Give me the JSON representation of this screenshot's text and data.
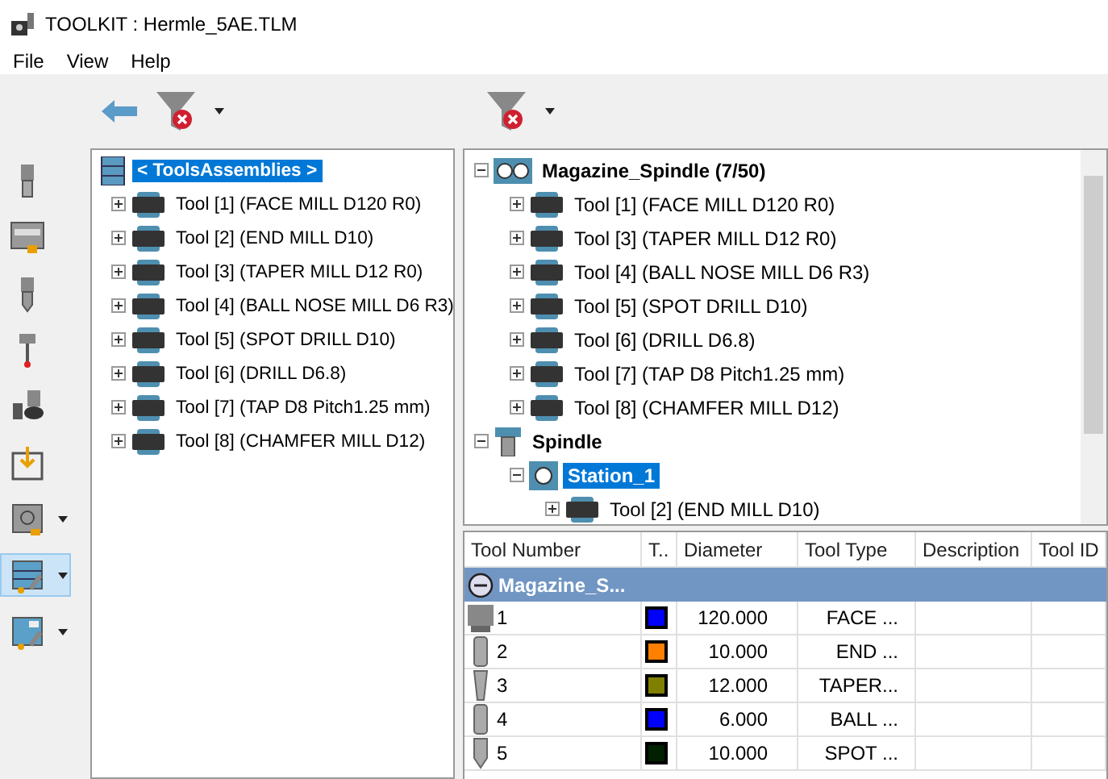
{
  "window": {
    "title": "TOOLKIT : Hermle_5AE.TLM"
  },
  "menu": [
    "File",
    "View",
    "Help"
  ],
  "left_toolbar": [
    {
      "kind": "endmill",
      "dropdown": false,
      "selected": false
    },
    {
      "kind": "holder",
      "dropdown": false,
      "selected": false
    },
    {
      "kind": "drill",
      "dropdown": false,
      "selected": false
    },
    {
      "kind": "probe",
      "dropdown": false,
      "selected": false
    },
    {
      "kind": "assembly",
      "dropdown": false,
      "selected": false
    },
    {
      "kind": "import",
      "dropdown": false,
      "selected": false
    },
    {
      "kind": "safe",
      "dropdown": true,
      "selected": false
    },
    {
      "kind": "table",
      "dropdown": true,
      "selected": true
    },
    {
      "kind": "split",
      "dropdown": true,
      "selected": false
    }
  ],
  "left_tree": [
    {
      "label": "< ToolsAssemblies >",
      "kind": "assemblies",
      "selected": true,
      "children": [
        {
          "label": "Tool [1] (FACE MILL D120 R0)",
          "kind": "tool",
          "expanded": false,
          "selected": false
        },
        {
          "label": "Tool [2] (END MILL D10)",
          "kind": "tool",
          "expanded": false,
          "selected": false
        },
        {
          "label": "Tool [3] (TAPER MILL D12 R0)",
          "kind": "tool",
          "expanded": false,
          "selected": false
        },
        {
          "label": "Tool [4] (BALL NOSE MILL D6 R3)",
          "kind": "tool",
          "expanded": false,
          "selected": false
        },
        {
          "label": "Tool [5] (SPOT DRILL D10)",
          "kind": "tool",
          "expanded": false,
          "selected": false
        },
        {
          "label": "Tool [6] (DRILL D6.8)",
          "kind": "tool",
          "expanded": false,
          "selected": false
        },
        {
          "label": "Tool [7] (TAP D8 Pitch1.25 mm)",
          "kind": "tool",
          "expanded": false,
          "selected": false
        },
        {
          "label": "Tool [8] (CHAMFER MILL D12)",
          "kind": "tool",
          "expanded": false,
          "selected": false
        }
      ]
    }
  ],
  "right_tree": [
    {
      "label": "Magazine_Spindle (7/50)",
      "kind": "magazine",
      "expanded": true,
      "selected": false,
      "children": [
        {
          "label": "Tool [1] (FACE MILL D120 R0)",
          "kind": "tool",
          "expanded": false,
          "selected": false
        },
        {
          "label": "Tool [3] (TAPER MILL D12 R0)",
          "kind": "tool",
          "expanded": false,
          "selected": false
        },
        {
          "label": "Tool [4] (BALL NOSE MILL D6 R3)",
          "kind": "tool",
          "expanded": false,
          "selected": false
        },
        {
          "label": "Tool [5] (SPOT DRILL D10)",
          "kind": "tool",
          "expanded": false,
          "selected": false
        },
        {
          "label": "Tool [6] (DRILL D6.8)",
          "kind": "tool",
          "expanded": false,
          "selected": false
        },
        {
          "label": "Tool [7] (TAP D8 Pitch1.25 mm)",
          "kind": "tool",
          "expanded": false,
          "selected": false
        },
        {
          "label": "Tool [8] (CHAMFER MILL D12)",
          "kind": "tool",
          "expanded": false,
          "selected": false
        }
      ]
    },
    {
      "label": "Spindle",
      "kind": "spindle",
      "expanded": true,
      "selected": false,
      "children": [
        {
          "label": "Station_1",
          "kind": "station",
          "expanded": true,
          "selected": true,
          "children": [
            {
              "label": "Tool [2] (END MILL D10)",
              "kind": "tool",
              "expanded": false,
              "selected": false
            }
          ]
        }
      ]
    }
  ],
  "table": {
    "columns": [
      "Tool Number",
      "T..",
      "Diameter",
      "Tool Type",
      "Description",
      "Tool ID"
    ],
    "group": "Magazine_S...",
    "rows": [
      {
        "number": "1",
        "kind": "face",
        "color": "#0000ff",
        "diameter": "120.000",
        "type": "FACE ..."
      },
      {
        "number": "2",
        "kind": "end",
        "color": "#ff8000",
        "diameter": "10.000",
        "type": "END ..."
      },
      {
        "number": "3",
        "kind": "taper",
        "color": "#808000",
        "diameter": "12.000",
        "type": "TAPER..."
      },
      {
        "number": "4",
        "kind": "ball",
        "color": "#0000ff",
        "diameter": "6.000",
        "type": "BALL ..."
      },
      {
        "number": "5",
        "kind": "spot",
        "color": "#002000",
        "diameter": "10.000",
        "type": "SPOT ..."
      }
    ]
  }
}
